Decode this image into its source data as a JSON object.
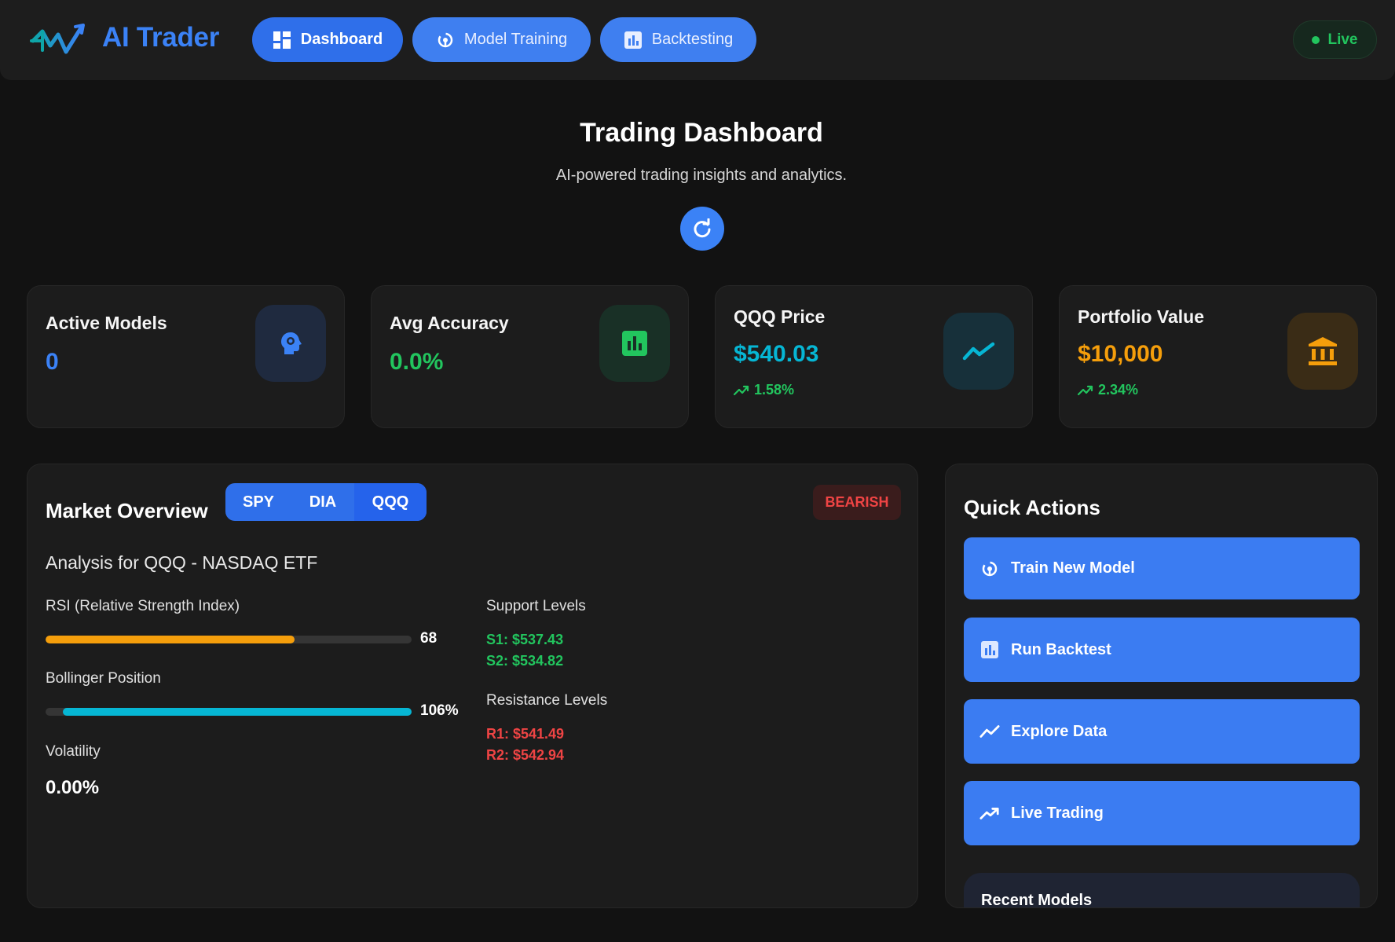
{
  "header": {
    "brand": "AI Trader",
    "logo_icon": "chart-line-logo-icon",
    "nav": [
      {
        "label": "Dashboard",
        "icon": "dashboard-grid-icon",
        "active": true
      },
      {
        "label": "Model Training",
        "icon": "brain-gear-icon",
        "active": false
      },
      {
        "label": "Backtesting",
        "icon": "bar-chart-icon",
        "active": false
      }
    ],
    "status": "Live"
  },
  "hero": {
    "title": "Trading Dashboard",
    "subtitle": "AI-powered trading insights and analytics.",
    "refresh_icon": "refresh-icon"
  },
  "stats": [
    {
      "label": "Active Models",
      "value": "0",
      "color": "#3b82f6",
      "icon": "brain-icon",
      "icon_bg": "#1f2a3f",
      "icon_color": "#3b82f6"
    },
    {
      "label": "Avg Accuracy",
      "value": "0.0%",
      "color": "#22c55e",
      "icon": "bar-chart-icon",
      "icon_bg": "#193026",
      "icon_color": "#22c55e"
    },
    {
      "label": "QQQ Price",
      "value": "$540.03",
      "change": "1.58%",
      "color": "#06b6d4",
      "icon": "trend-line-icon",
      "icon_bg": "#17303a",
      "icon_color": "#06b6d4"
    },
    {
      "label": "Portfolio Value",
      "value": "$10,000",
      "change": "2.34%",
      "color": "#f59e0b",
      "icon": "bank-icon",
      "icon_bg": "#3a2c16",
      "icon_color": "#f59e0b"
    }
  ],
  "market": {
    "title": "Market Overview",
    "tabs": [
      "SPY",
      "DIA",
      "QQQ"
    ],
    "selected_tab": "QQQ",
    "sentiment": "BEARISH",
    "analysis_title": "Analysis for QQQ - NASDAQ ETF",
    "rsi": {
      "label": "RSI (Relative Strength Index)",
      "value": "68",
      "fill_fraction": 0.68,
      "color": "#f59e0b"
    },
    "bollinger": {
      "label": "Bollinger Position",
      "value": "106%",
      "fill_fraction": 1.0,
      "color": "#06b6d4"
    },
    "volatility": {
      "label": "Volatility",
      "value": "0.00%"
    },
    "support": {
      "label": "Support Levels",
      "levels": [
        "S1: $537.43",
        "S2: $534.82"
      ]
    },
    "resistance": {
      "label": "Resistance Levels",
      "levels": [
        "R1: $541.49",
        "R2: $542.94"
      ]
    }
  },
  "quick_actions": {
    "title": "Quick Actions",
    "buttons": [
      {
        "label": "Train New Model",
        "icon": "brain-gear-icon"
      },
      {
        "label": "Run Backtest",
        "icon": "bar-chart-icon"
      },
      {
        "label": "Explore Data",
        "icon": "trend-line-icon"
      },
      {
        "label": "Live Trading",
        "icon": "trending-up-icon"
      }
    ],
    "recent_models_title": "Recent Models"
  }
}
